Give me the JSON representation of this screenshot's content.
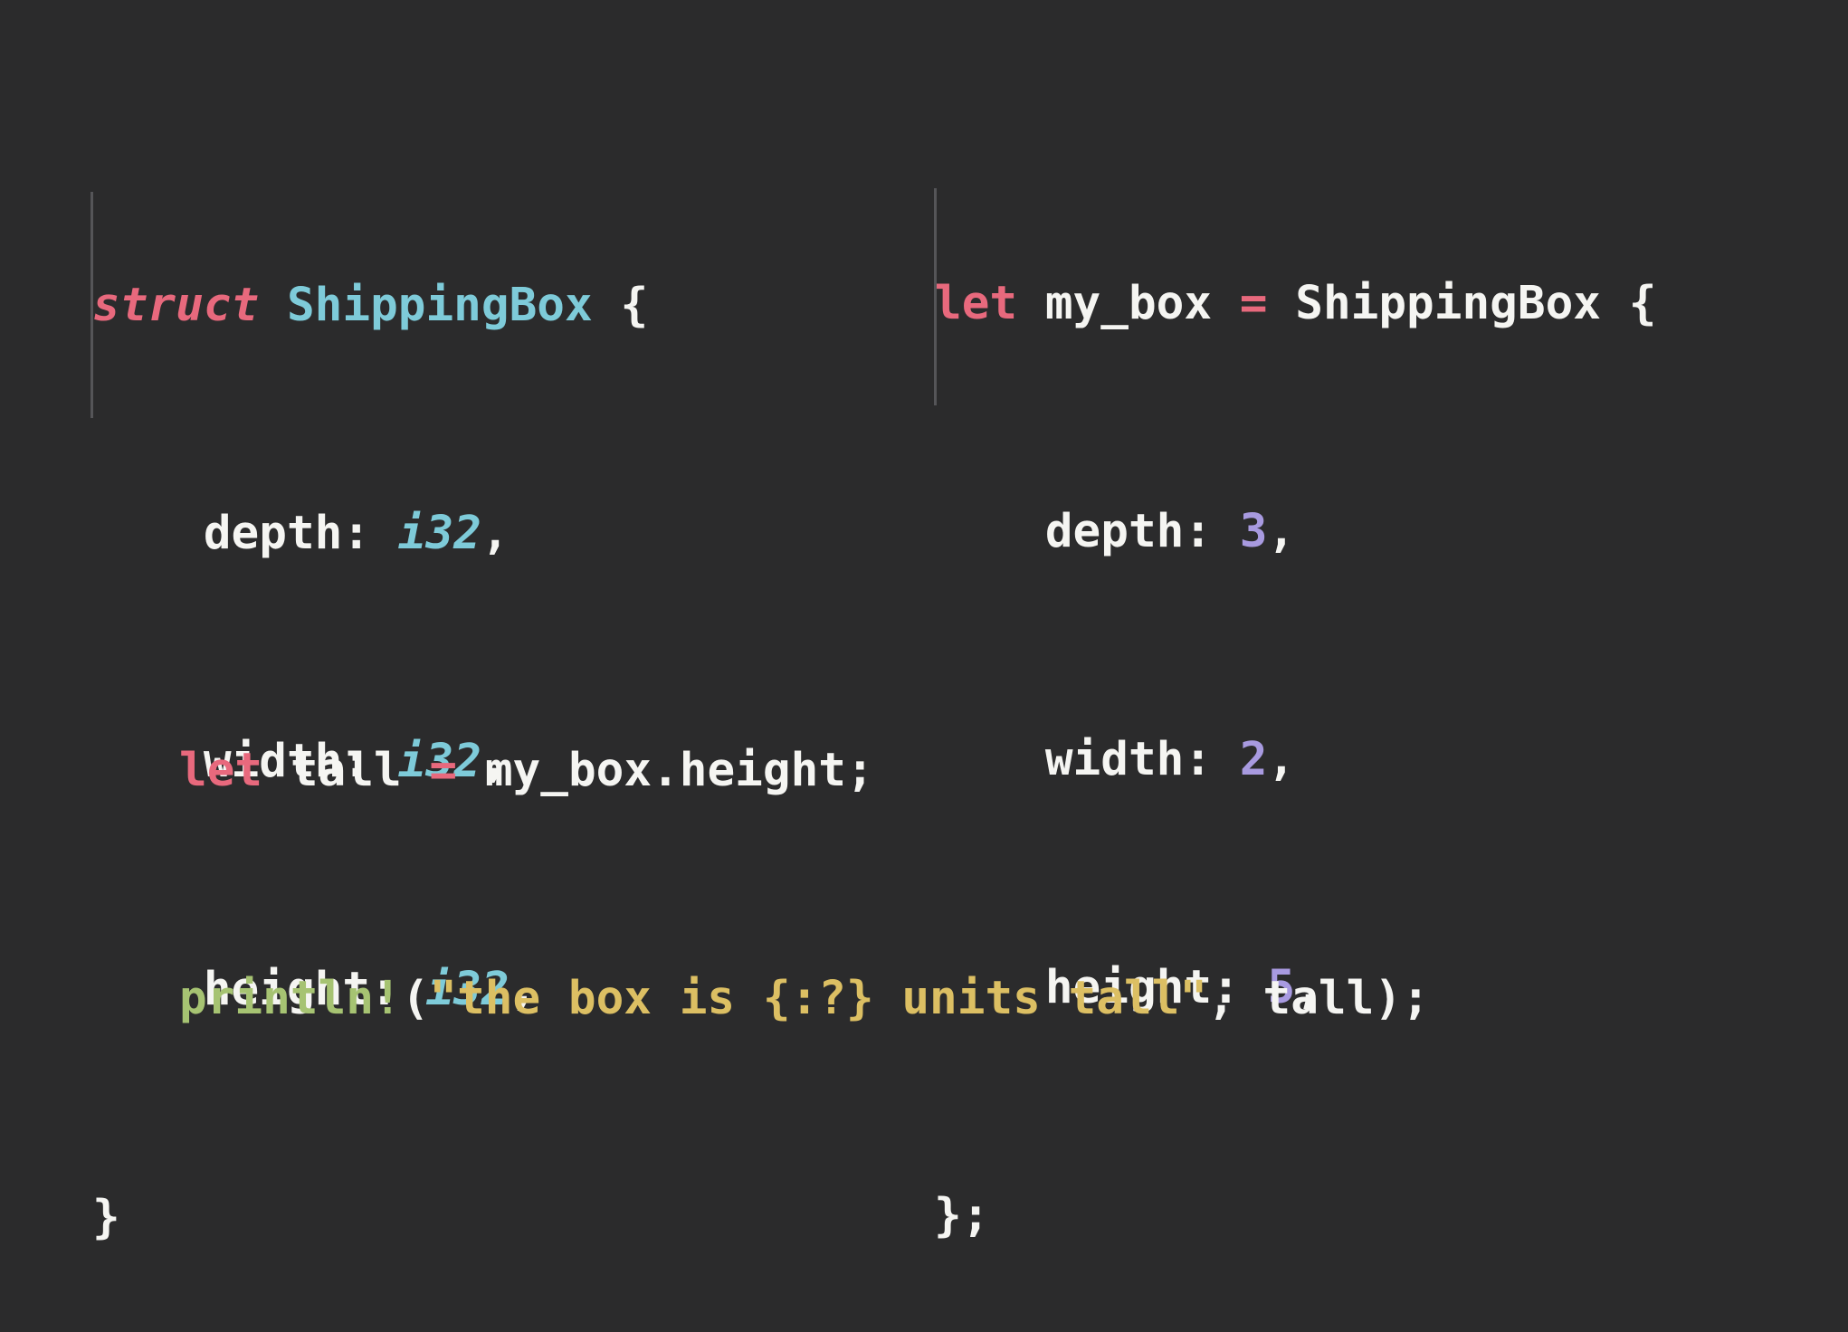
{
  "struct_block": {
    "keyword": "struct",
    "name": "ShippingBox",
    "open_brace": "{",
    "fields": [
      {
        "name": "depth",
        "colon": ":",
        "type": "i32",
        "comma": ","
      },
      {
        "name": "width",
        "colon": ":",
        "type": "i32",
        "comma": ","
      },
      {
        "name": "height",
        "colon": ":",
        "type": "i32",
        "comma": ","
      }
    ],
    "close_brace": "}"
  },
  "instance_block": {
    "keyword": "let",
    "var_name": "my_box",
    "equals": "=",
    "type_name": "ShippingBox",
    "open_brace": "{",
    "fields": [
      {
        "name": "depth",
        "colon": ":",
        "value": "3",
        "comma": ","
      },
      {
        "name": "width",
        "colon": ":",
        "value": "2",
        "comma": ","
      },
      {
        "name": "height",
        "colon": ":",
        "value": "5",
        "comma": ","
      }
    ],
    "close": "};"
  },
  "access_block": {
    "line1": {
      "keyword": "let",
      "var_name": "tall",
      "equals": "=",
      "expr": "my_box.height;"
    },
    "line2": {
      "macro": "println!",
      "open_paren": "(",
      "string": "\"the box is {:?} units tall\"",
      "rest": ", tall);"
    }
  },
  "colors": {
    "background": "#2b2b2c",
    "keyword": "#e8697d",
    "type": "#7ecbd9",
    "number": "#a89ae0",
    "macro": "#a6c372",
    "string": "#dcbf63",
    "text": "#f5f5f2"
  }
}
